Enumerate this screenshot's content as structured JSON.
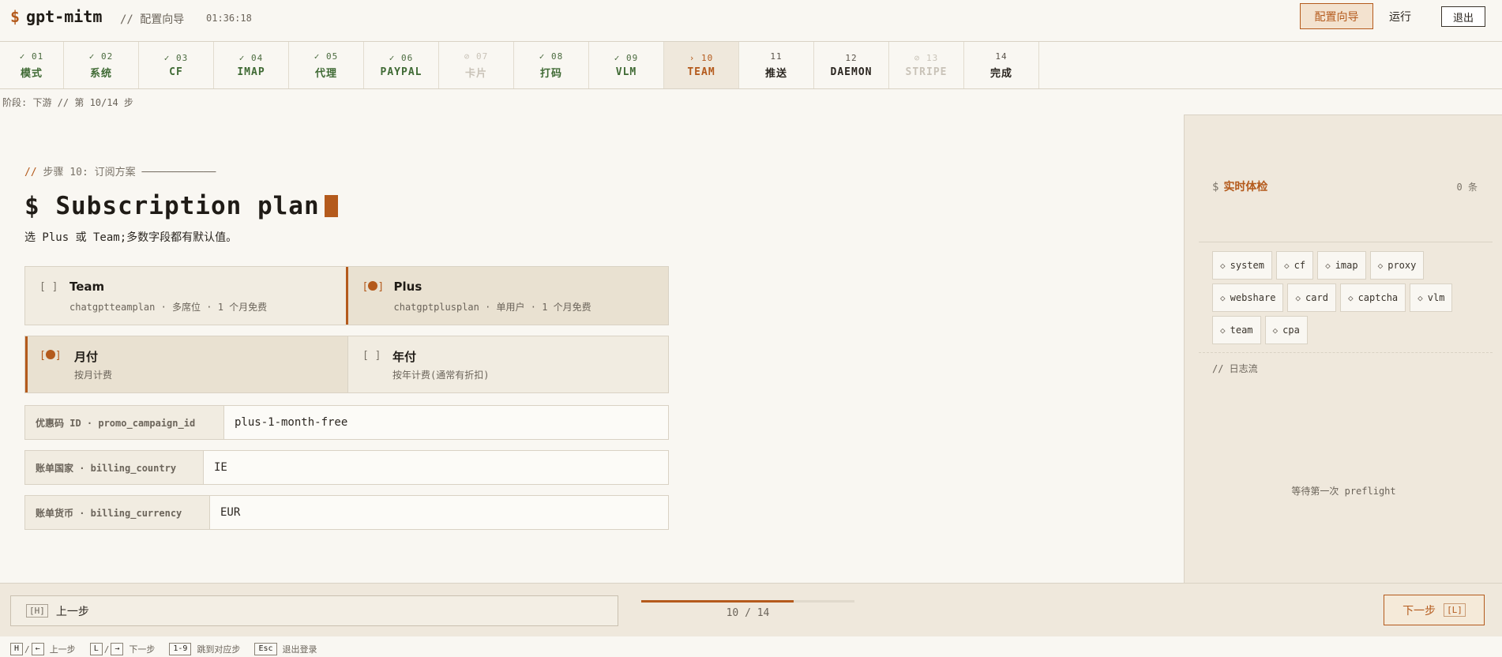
{
  "app": {
    "dollar": "$",
    "name": "gpt-mitm",
    "crumb": "// 配置向导",
    "clock": "01:36:18"
  },
  "nav": {
    "wizard": "配置向导",
    "run": "运行",
    "exit": "退出"
  },
  "steps": [
    {
      "num": "✓ 01",
      "label": "模式",
      "state": "done"
    },
    {
      "num": "✓ 02",
      "label": "系统",
      "state": "done"
    },
    {
      "num": "✓ 03",
      "label": "CF",
      "state": "done"
    },
    {
      "num": "✓ 04",
      "label": "IMAP",
      "state": "done"
    },
    {
      "num": "✓ 05",
      "label": "代理",
      "state": "done"
    },
    {
      "num": "✓ 06",
      "label": "PAYPAL",
      "state": "done"
    },
    {
      "num": "⊘ 07",
      "label": "卡片",
      "state": "disabled"
    },
    {
      "num": "✓ 08",
      "label": "打码",
      "state": "done"
    },
    {
      "num": "✓ 09",
      "label": "VLM",
      "state": "done"
    },
    {
      "num": "› 10",
      "label": "TEAM",
      "state": "current"
    },
    {
      "num": "11",
      "label": "推送",
      "state": "todo"
    },
    {
      "num": "12",
      "label": "DAEMON",
      "state": "todo"
    },
    {
      "num": "⊘ 13",
      "label": "STRIPE",
      "state": "disabled"
    },
    {
      "num": "14",
      "label": "完成",
      "state": "todo"
    }
  ],
  "phase": "阶段: 下游 // 第 10/14 步",
  "section": {
    "slashes": "//",
    "title": "步骤 10: 订阅方案 ────────────",
    "heading": "$ Subscription plan",
    "subtitle": "选 Plus 或 Team;多数字段都有默认值。"
  },
  "plans": [
    {
      "radio": "[ ]",
      "title": "Team",
      "desc": "chatgptteamplan · 多席位 · 1 个月免费",
      "selected": false
    },
    {
      "radio_open": "[",
      "radio_close": "]",
      "title": "Plus",
      "desc": "chatgptplusplan · 单用户 · 1 个月免费",
      "selected": true
    }
  ],
  "billing": [
    {
      "radio_open": "[",
      "radio_close": "]",
      "title": "月付",
      "desc": "按月计费",
      "selected": true
    },
    {
      "radio": "[ ]",
      "title": "年付",
      "desc": "按年计费(通常有折扣)",
      "selected": false
    }
  ],
  "fields": [
    {
      "label": "优惠码 ID · promo_campaign_id",
      "value": "plus-1-month-free"
    },
    {
      "label": "账单国家 · billing_country",
      "value": "IE"
    },
    {
      "label": "账单货币 · billing_currency",
      "value": "EUR"
    }
  ],
  "side": {
    "dollar": "$",
    "title": "实时体检",
    "count": "0 条",
    "chips": [
      "system",
      "cf",
      "imap",
      "proxy",
      "webshare",
      "card",
      "captcha",
      "vlm",
      "team",
      "cpa"
    ],
    "chip_icon": "◇",
    "log_title": "// 日志流",
    "waiting": "等待第一次 preflight"
  },
  "footer": {
    "prev_key": "[H]",
    "prev_label": "上一步",
    "progress": 0.7143,
    "progress_text": "10 / 14",
    "next_label": "下一步",
    "next_key": "[L]"
  },
  "hints": [
    {
      "k1": "H",
      "k2": "←",
      "label": "上一步"
    },
    {
      "k1": "L",
      "k2": "→",
      "label": "下一步"
    },
    {
      "k1": "1-9",
      "label": "跳到对应步"
    },
    {
      "k1": "Esc",
      "label": "退出登录"
    }
  ]
}
